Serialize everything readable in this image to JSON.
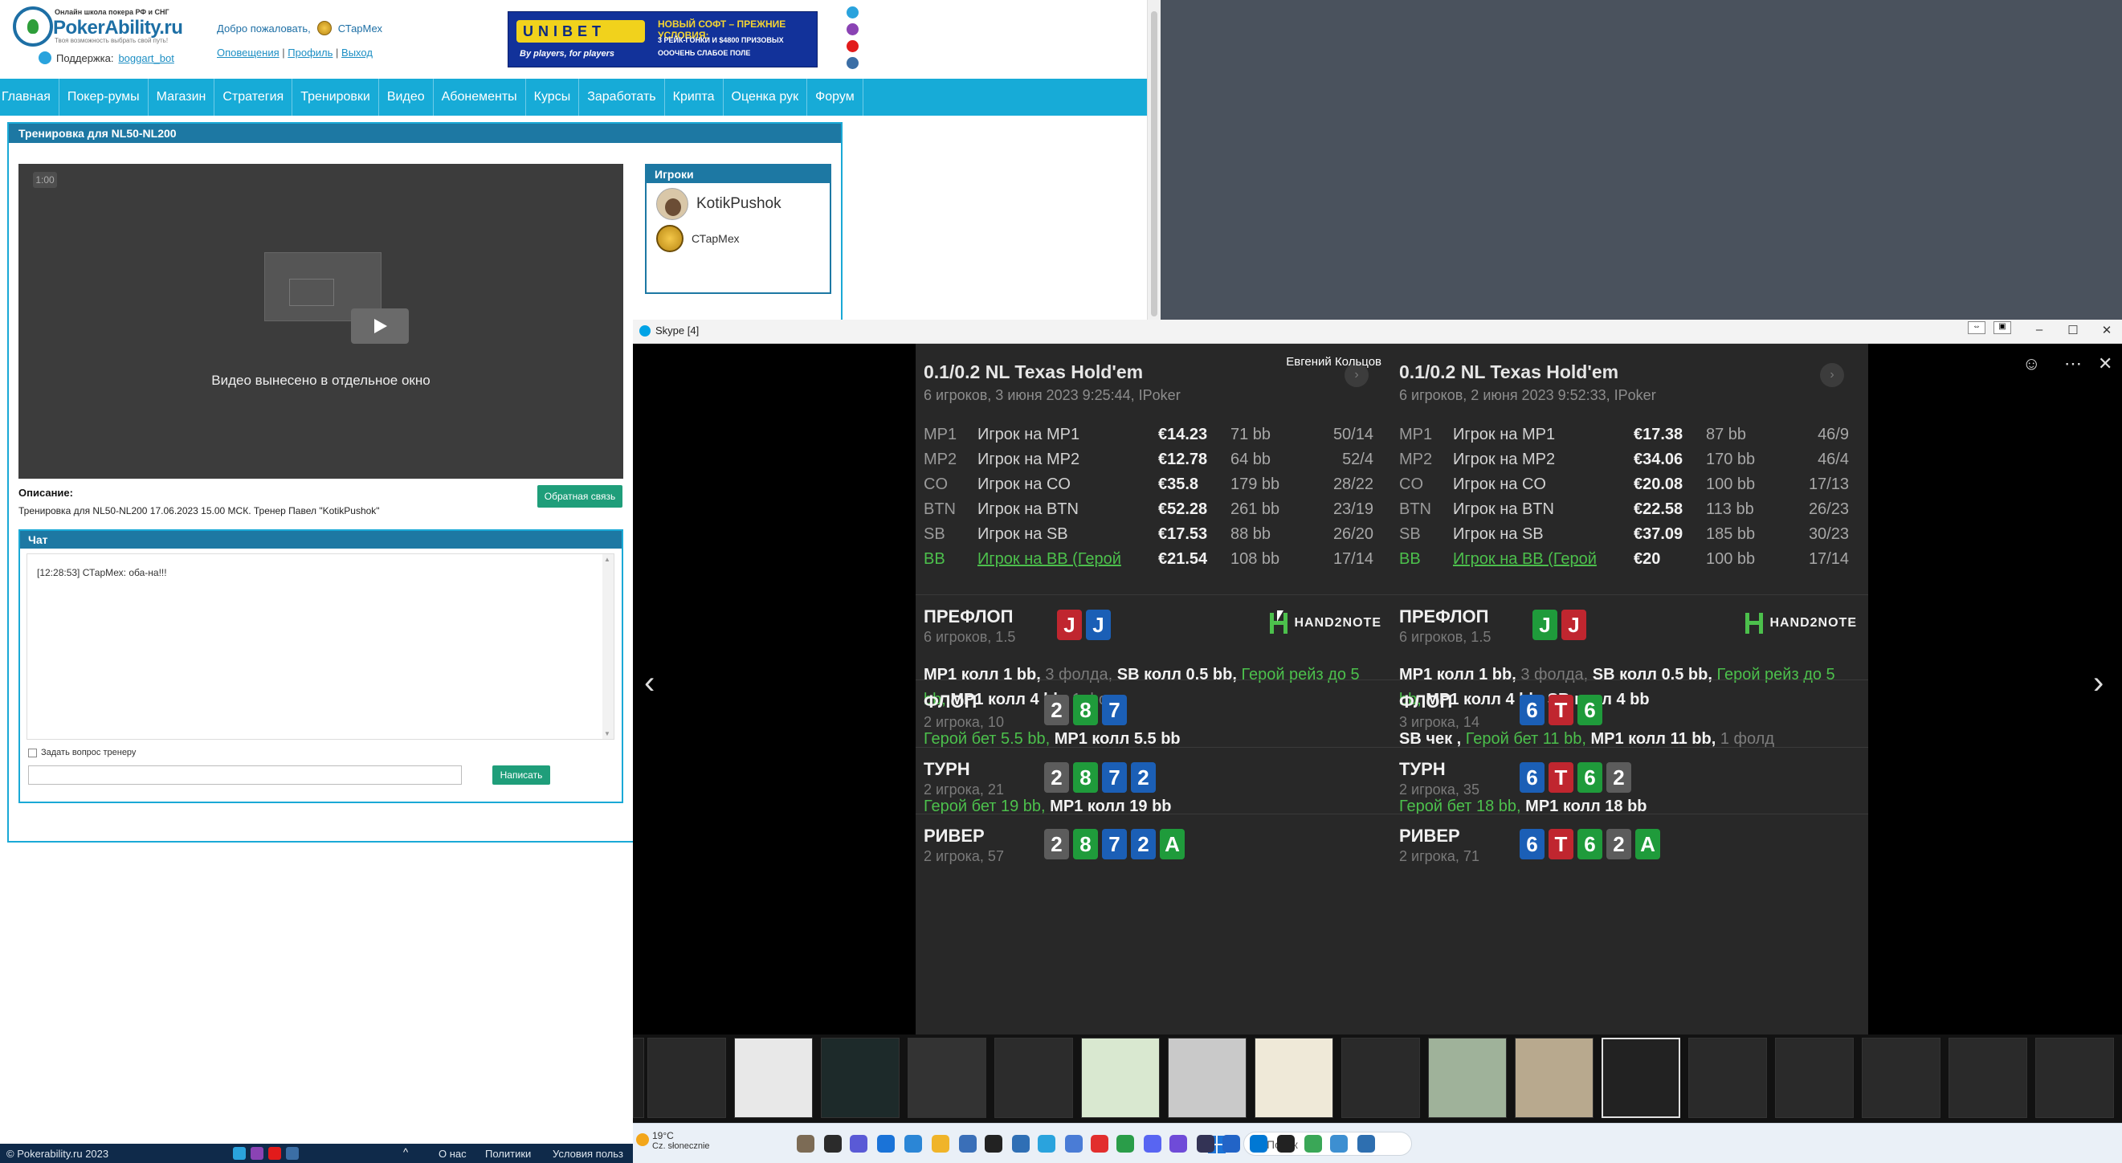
{
  "site": {
    "logo": {
      "tagline": "Онлайн школа покера РФ и СНГ",
      "name": "PokerAbility.ru",
      "slogan": "Твоя возможность выбрать свой путь!"
    },
    "support": {
      "label": "Поддержка:",
      "link": "boggart_bot"
    },
    "welcome": {
      "text": "Добро пожаловать,",
      "user": "СТарМех"
    },
    "userlinks": {
      "notifications": "Оповещения",
      "profile": "Профиль",
      "logout": "Выход",
      "sep": "|"
    },
    "banner": {
      "brand": "UNIBET",
      "slogan": "By players, for players",
      "title": "НОВЫЙ СОФТ – ПРЕЖНИЕ УСЛОВИЯ:",
      "lines": [
        "3 РЕЙК-ГОНКИ И $4800 ПРИЗОВЫХ",
        "ОООЧЕНЬ СЛАБОЕ ПОЛЕ"
      ]
    },
    "nav": [
      "Главная",
      "Покер-румы",
      "Магазин",
      "Стратегия",
      "Тренировки",
      "Видео",
      "Абонементы",
      "Курсы",
      "Заработать",
      "Крипта",
      "Оценка рук",
      "Форум"
    ],
    "training": {
      "title": "Тренировка для NL50-NL200",
      "video_time": "1:00",
      "video_msg": "Видео вынесено в отдельное окно",
      "players_title": "Игроки",
      "players": [
        "KotikPushok",
        "СТарМех"
      ],
      "desc_label": "Описание:",
      "desc_text": "Тренировка для NL50-NL200 17.06.2023 15.00 МСК. Тренер Павел \"KotikPushok\"",
      "feedback_btn": "Обратная связь",
      "chat_title": "Чат",
      "chat_msg": "[12:28:53] СТарМех: оба-на!!!",
      "ask_label": "Задать вопрос тренеру",
      "send_btn": "Написать"
    },
    "footer": {
      "copy": "© Pokerability.ru 2023",
      "links": [
        "О нас",
        "Политики",
        "Условия польз"
      ]
    }
  },
  "skype": {
    "title": "Skype [4]",
    "hands": [
      {
        "title": "0.1/0.2 NL Texas Hold'em",
        "sub": "6 игроков, 3 июня 2023 9:25:44, IPoker",
        "author": "Евгений Кольцов",
        "players": [
          {
            "pos": "MP1",
            "name": "Игрок на MP1",
            "stack": "€14.23",
            "bb": "71 bb",
            "stat": "50/14"
          },
          {
            "pos": "MP2",
            "name": "Игрок на MP2",
            "stack": "€12.78",
            "bb": "64 bb",
            "stat": "52/4"
          },
          {
            "pos": "CO",
            "name": "Игрок на CO",
            "stack": "€35.8",
            "bb": "179 bb",
            "stat": "28/22"
          },
          {
            "pos": "BTN",
            "name": "Игрок на BTN",
            "stack": "€52.28",
            "bb": "261 bb",
            "stat": "23/19"
          },
          {
            "pos": "SB",
            "name": "Игрок на SB",
            "stack": "€17.53",
            "bb": "88 bb",
            "stat": "26/20"
          },
          {
            "pos": "BB",
            "name": "Игрок на BB (Герой",
            "stack": "€21.54",
            "bb": "108 bb",
            "stat": "17/14"
          }
        ],
        "preflop": {
          "name": "ПРЕФЛОП",
          "sub": "6 игроков, 1.5",
          "cards": [
            {
              "r": "J",
              "c": "#c0262f"
            },
            {
              "r": "J",
              "c": "#1b5fb6"
            }
          ]
        },
        "preflop_act": [
          [
            "w",
            "MP1 "
          ],
          [
            "w",
            "колл 1 bb, "
          ],
          [
            "x",
            "3 фолда, "
          ],
          [
            "w",
            "SB "
          ],
          [
            "w",
            "колл 0.5 bb, "
          ],
          [
            "g",
            "Герой рейз до 5 bb, "
          ],
          [
            "w",
            "MP1 "
          ],
          [
            "w",
            "колл 4 bb, "
          ],
          [
            "x",
            "1 фолд"
          ]
        ],
        "flop": {
          "name": "ФЛОП",
          "sub": "2 игрока, 10",
          "cards": [
            {
              "r": "2",
              "c": "#5c5c5c"
            },
            {
              "r": "8",
              "c": "#1f9b3b"
            },
            {
              "r": "7",
              "c": "#1b5fb6"
            }
          ]
        },
        "flop_act": [
          [
            "g",
            "Герой бет 5.5 bb, "
          ],
          [
            "w",
            "MP1 "
          ],
          [
            "w",
            "колл 5.5 bb"
          ]
        ],
        "turn": {
          "name": "ТУРН",
          "sub": "2 игрока, 21",
          "cards": [
            {
              "r": "2",
              "c": "#5c5c5c"
            },
            {
              "r": "8",
              "c": "#1f9b3b"
            },
            {
              "r": "7",
              "c": "#1b5fb6"
            },
            {
              "r": "2",
              "c": "#1b5fb6"
            }
          ]
        },
        "turn_act": [
          [
            "g",
            "Герой бет 19 bb, "
          ],
          [
            "w",
            "MP1 "
          ],
          [
            "w",
            "колл 19 bb"
          ]
        ],
        "river": {
          "name": "РИВЕР",
          "sub": "2 игрока, 57",
          "cards": [
            {
              "r": "2",
              "c": "#5c5c5c"
            },
            {
              "r": "8",
              "c": "#1f9b3b"
            },
            {
              "r": "7",
              "c": "#1b5fb6"
            },
            {
              "r": "2",
              "c": "#1b5fb6"
            },
            {
              "r": "A",
              "c": "#1f9b3b"
            }
          ]
        }
      },
      {
        "title": "0.1/0.2 NL Texas Hold'em",
        "sub": "6 игроков, 2 июня 2023 9:52:33, IPoker",
        "author": "",
        "players": [
          {
            "pos": "MP1",
            "name": "Игрок на MP1",
            "stack": "€17.38",
            "bb": "87 bb",
            "stat": "46/9"
          },
          {
            "pos": "MP2",
            "name": "Игрок на MP2",
            "stack": "€34.06",
            "bb": "170 bb",
            "stat": "46/4"
          },
          {
            "pos": "CO",
            "name": "Игрок на CO",
            "stack": "€20.08",
            "bb": "100 bb",
            "stat": "17/13"
          },
          {
            "pos": "BTN",
            "name": "Игрок на BTN",
            "stack": "€22.58",
            "bb": "113 bb",
            "stat": "26/23"
          },
          {
            "pos": "SB",
            "name": "Игрок на SB",
            "stack": "€37.09",
            "bb": "185 bb",
            "stat": "30/23"
          },
          {
            "pos": "BB",
            "name": "Игрок на BB (Герой",
            "stack": "€20",
            "bb": "100 bb",
            "stat": "17/14"
          }
        ],
        "preflop": {
          "name": "ПРЕФЛОП",
          "sub": "6 игроков, 1.5",
          "cards": [
            {
              "r": "J",
              "c": "#1f9b3b"
            },
            {
              "r": "J",
              "c": "#c0262f"
            }
          ]
        },
        "preflop_act": [
          [
            "w",
            "MP1 "
          ],
          [
            "w",
            "колл 1 bb, "
          ],
          [
            "x",
            "3 фолда, "
          ],
          [
            "w",
            "SB "
          ],
          [
            "w",
            "колл 0.5 bb, "
          ],
          [
            "g",
            "Герой рейз до 5 bb, "
          ],
          [
            "w",
            "MP1 "
          ],
          [
            "w",
            "колл 4 bb, "
          ],
          [
            "w",
            "SB "
          ],
          [
            "w",
            "колл 4 bb"
          ]
        ],
        "flop": {
          "name": "ФЛОП",
          "sub": "3 игрока, 14",
          "cards": [
            {
              "r": "6",
              "c": "#1b5fb6"
            },
            {
              "r": "T",
              "c": "#c0262f"
            },
            {
              "r": "6",
              "c": "#1f9b3b"
            }
          ]
        },
        "flop_act": [
          [
            "w",
            "SB "
          ],
          [
            "w",
            "чек , "
          ],
          [
            "g",
            "Герой бет 11 bb, "
          ],
          [
            "w",
            "MP1 "
          ],
          [
            "w",
            "колл 11 bb, "
          ],
          [
            "x",
            "1 фолд"
          ]
        ],
        "turn": {
          "name": "ТУРН",
          "sub": "2 игрока, 35",
          "cards": [
            {
              "r": "6",
              "c": "#1b5fb6"
            },
            {
              "r": "T",
              "c": "#c0262f"
            },
            {
              "r": "6",
              "c": "#1f9b3b"
            },
            {
              "r": "2",
              "c": "#5c5c5c"
            }
          ]
        },
        "turn_act": [
          [
            "g",
            "Герой бет 18 bb, "
          ],
          [
            "w",
            "MP1 "
          ],
          [
            "w",
            "колл 18 bb"
          ]
        ],
        "river": {
          "name": "РИВЕР",
          "sub": "2 игрока, 71",
          "cards": [
            {
              "r": "6",
              "c": "#1b5fb6"
            },
            {
              "r": "T",
              "c": "#c0262f"
            },
            {
              "r": "6",
              "c": "#1f9b3b"
            },
            {
              "r": "2",
              "c": "#5c5c5c"
            },
            {
              "r": "A",
              "c": "#1f9b3b"
            }
          ]
        }
      }
    ],
    "h2n": "HAND2NOTE"
  },
  "taskbar": {
    "temp": "19°C",
    "weather": "Cz. słonecznie",
    "search": "Поиск"
  }
}
